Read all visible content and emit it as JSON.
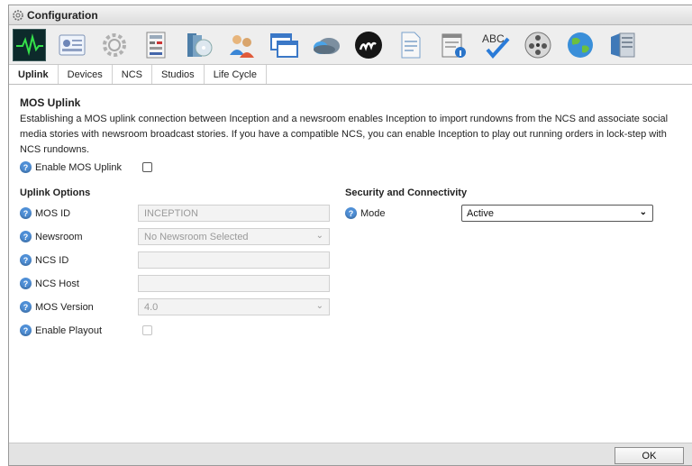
{
  "window": {
    "title": "Configuration"
  },
  "toolbar": {
    "icons": [
      "activity-monitor-icon",
      "user-card-icon",
      "settings-gear-icon",
      "keypad-panel-icon",
      "media-discs-icon",
      "users-icon",
      "windows-icon",
      "cloud-icon",
      "inception-logo-icon",
      "document-icon",
      "info-notepad-icon",
      "spellcheck-icon",
      "film-reel-icon",
      "globe-icon",
      "server-icon"
    ],
    "active": "activity-monitor-icon"
  },
  "tabs": [
    {
      "label": "Uplink",
      "active": true
    },
    {
      "label": "Devices",
      "active": false
    },
    {
      "label": "NCS",
      "active": false
    },
    {
      "label": "Studios",
      "active": false
    },
    {
      "label": "Life Cycle",
      "active": false
    }
  ],
  "main": {
    "heading": "MOS Uplink",
    "description": "Establishing a MOS uplink connection between Inception and a newsroom enables Inception to import rundowns from the NCS and associate social media stories with newsroom broadcast stories. If you have a compatible NCS, you can enable Inception to play out running orders in lock-step with NCS rundowns.",
    "enable_mos_label": "Enable MOS Uplink",
    "enable_mos_checked": false
  },
  "uplink_options": {
    "title": "Uplink Options",
    "mos_id": {
      "label": "MOS ID",
      "value": "INCEPTION"
    },
    "newsroom": {
      "label": "Newsroom",
      "value": "No Newsroom Selected"
    },
    "ncs_id": {
      "label": "NCS ID",
      "value": ""
    },
    "ncs_host": {
      "label": "NCS Host",
      "value": ""
    },
    "mos_version": {
      "label": "MOS Version",
      "value": "4.0"
    },
    "enable_playout": {
      "label": "Enable Playout",
      "checked": false
    }
  },
  "security": {
    "title": "Security and Connectivity",
    "mode": {
      "label": "Mode",
      "value": "Active"
    }
  },
  "footer": {
    "ok_label": "OK"
  },
  "help_glyph": "?",
  "chevron_glyph": "⌄",
  "colors": {
    "help": "#4f8fd6",
    "active_icon_bg": "#0d2a2b",
    "footer": "#e3e3e3"
  }
}
